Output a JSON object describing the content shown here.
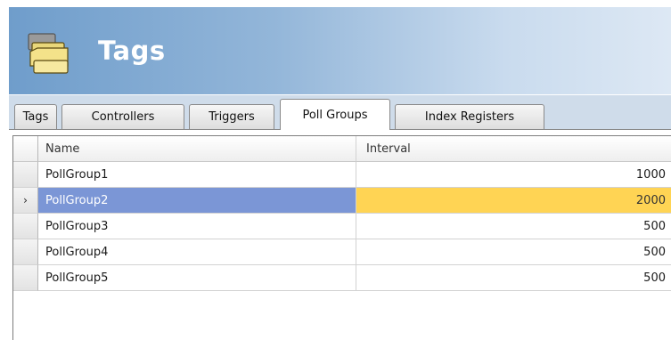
{
  "header": {
    "title": "Tags",
    "icon": "tags-folders-icon"
  },
  "tabs": [
    {
      "label": "Tags",
      "active": false
    },
    {
      "label": "Controllers",
      "active": false
    },
    {
      "label": "Triggers",
      "active": false
    },
    {
      "label": "Poll Groups",
      "active": true
    },
    {
      "label": "Index Registers",
      "active": false
    }
  ],
  "grid": {
    "columns": [
      "Name",
      "Interval"
    ],
    "rows": [
      {
        "name": "PollGroup1",
        "interval": "1000",
        "selected": false
      },
      {
        "name": "PollGroup2",
        "interval": "2000",
        "selected": true
      },
      {
        "name": "PollGroup3",
        "interval": "500",
        "selected": false
      },
      {
        "name": "PollGroup4",
        "interval": "500",
        "selected": false
      },
      {
        "name": "PollGroup5",
        "interval": "500",
        "selected": false
      }
    ],
    "current_row_indicator": "›"
  },
  "colors": {
    "selected_name_bg": "#7b96d6",
    "selected_cell_bg": "#ffd454",
    "header_gradient_start": "#6f9dcb"
  }
}
